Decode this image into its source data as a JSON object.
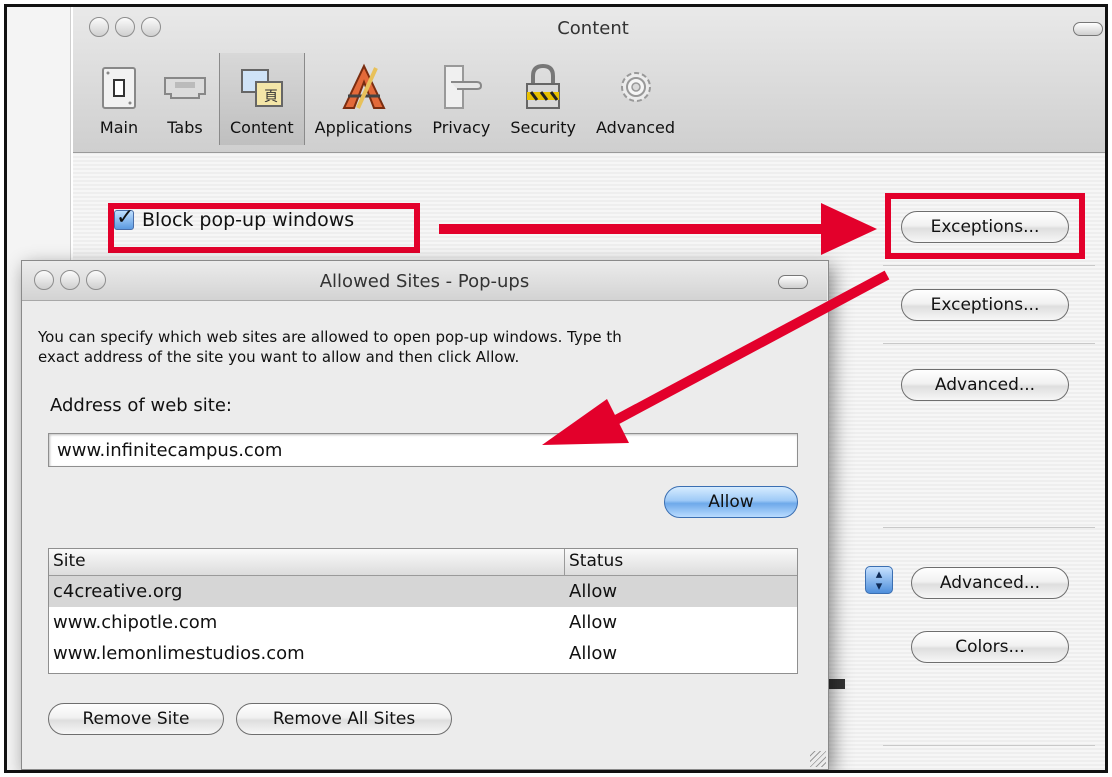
{
  "pref_window": {
    "title": "Content",
    "toolbar": [
      {
        "label": "Main",
        "icon": "switch-icon"
      },
      {
        "label": "Tabs",
        "icon": "tabs-icon"
      },
      {
        "label": "Content",
        "icon": "content-icon",
        "selected": true
      },
      {
        "label": "Applications",
        "icon": "applications-icon"
      },
      {
        "label": "Privacy",
        "icon": "privacy-icon"
      },
      {
        "label": "Security",
        "icon": "lock-icon"
      },
      {
        "label": "Advanced",
        "icon": "gear-icon"
      }
    ],
    "block_popups_label": "Block pop-up windows",
    "block_popups_checked": true,
    "buttons": {
      "exceptions_1": "Exceptions...",
      "exceptions_2": "Exceptions...",
      "advanced_1": "Advanced...",
      "advanced_2": "Advanced...",
      "colors": "Colors..."
    }
  },
  "dialog": {
    "title": "Allowed Sites - Pop-ups",
    "description_line1": "You can specify which web sites are allowed to open pop-up windows. Type th",
    "description_line2": "exact address of the site you want to allow and then click Allow.",
    "address_label": "Address of web site:",
    "address_value": "www.infinitecampus.com",
    "allow_button": "Allow",
    "columns": {
      "site": "Site",
      "status": "Status"
    },
    "rows": [
      {
        "site": "c4creative.org",
        "status": "Allow"
      },
      {
        "site": "www.chipotle.com",
        "status": "Allow"
      },
      {
        "site": "www.lemonlimestudios.com",
        "status": "Allow"
      }
    ],
    "remove_site": "Remove Site",
    "remove_all_sites": "Remove All Sites"
  },
  "colors": {
    "annotation_red": "#e3002b",
    "aqua_blue": "#6ea9ea"
  }
}
